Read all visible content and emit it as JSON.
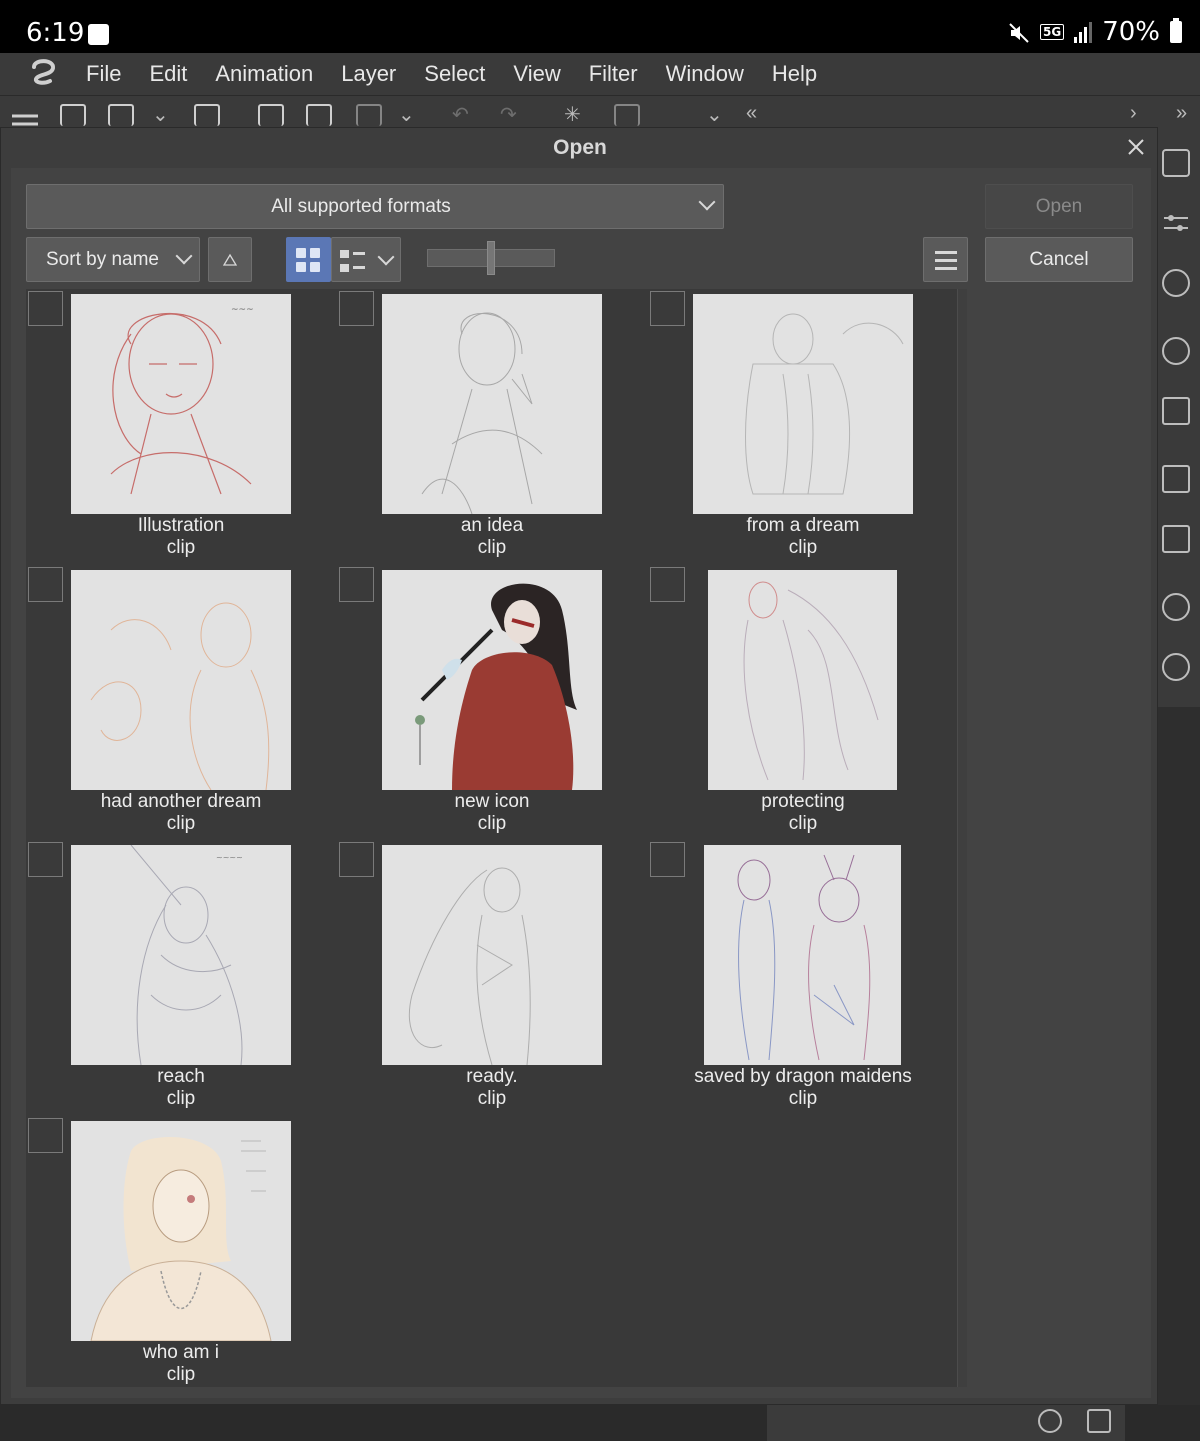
{
  "status_bar": {
    "time": "6:19",
    "network": "5G",
    "battery": "70%"
  },
  "menu": {
    "items": [
      "File",
      "Edit",
      "Animation",
      "Layer",
      "Select",
      "View",
      "Filter",
      "Window",
      "Help"
    ]
  },
  "dialog": {
    "title": "Open",
    "format_filter": "All supported formats",
    "sort_by": "Sort by name",
    "open_button": "Open",
    "cancel_button": "Cancel",
    "view_mode": "grid"
  },
  "files": [
    {
      "name": "Illustration",
      "ext": "clip"
    },
    {
      "name": "an idea",
      "ext": "clip"
    },
    {
      "name": "from a dream",
      "ext": "clip"
    },
    {
      "name": "had another dream",
      "ext": "clip"
    },
    {
      "name": "new icon",
      "ext": "clip"
    },
    {
      "name": "protecting",
      "ext": "clip"
    },
    {
      "name": "reach",
      "ext": "clip"
    },
    {
      "name": "ready.",
      "ext": "clip"
    },
    {
      "name": "saved by dragon maidens",
      "ext": "clip"
    },
    {
      "name": "who am i",
      "ext": "clip"
    }
  ]
}
